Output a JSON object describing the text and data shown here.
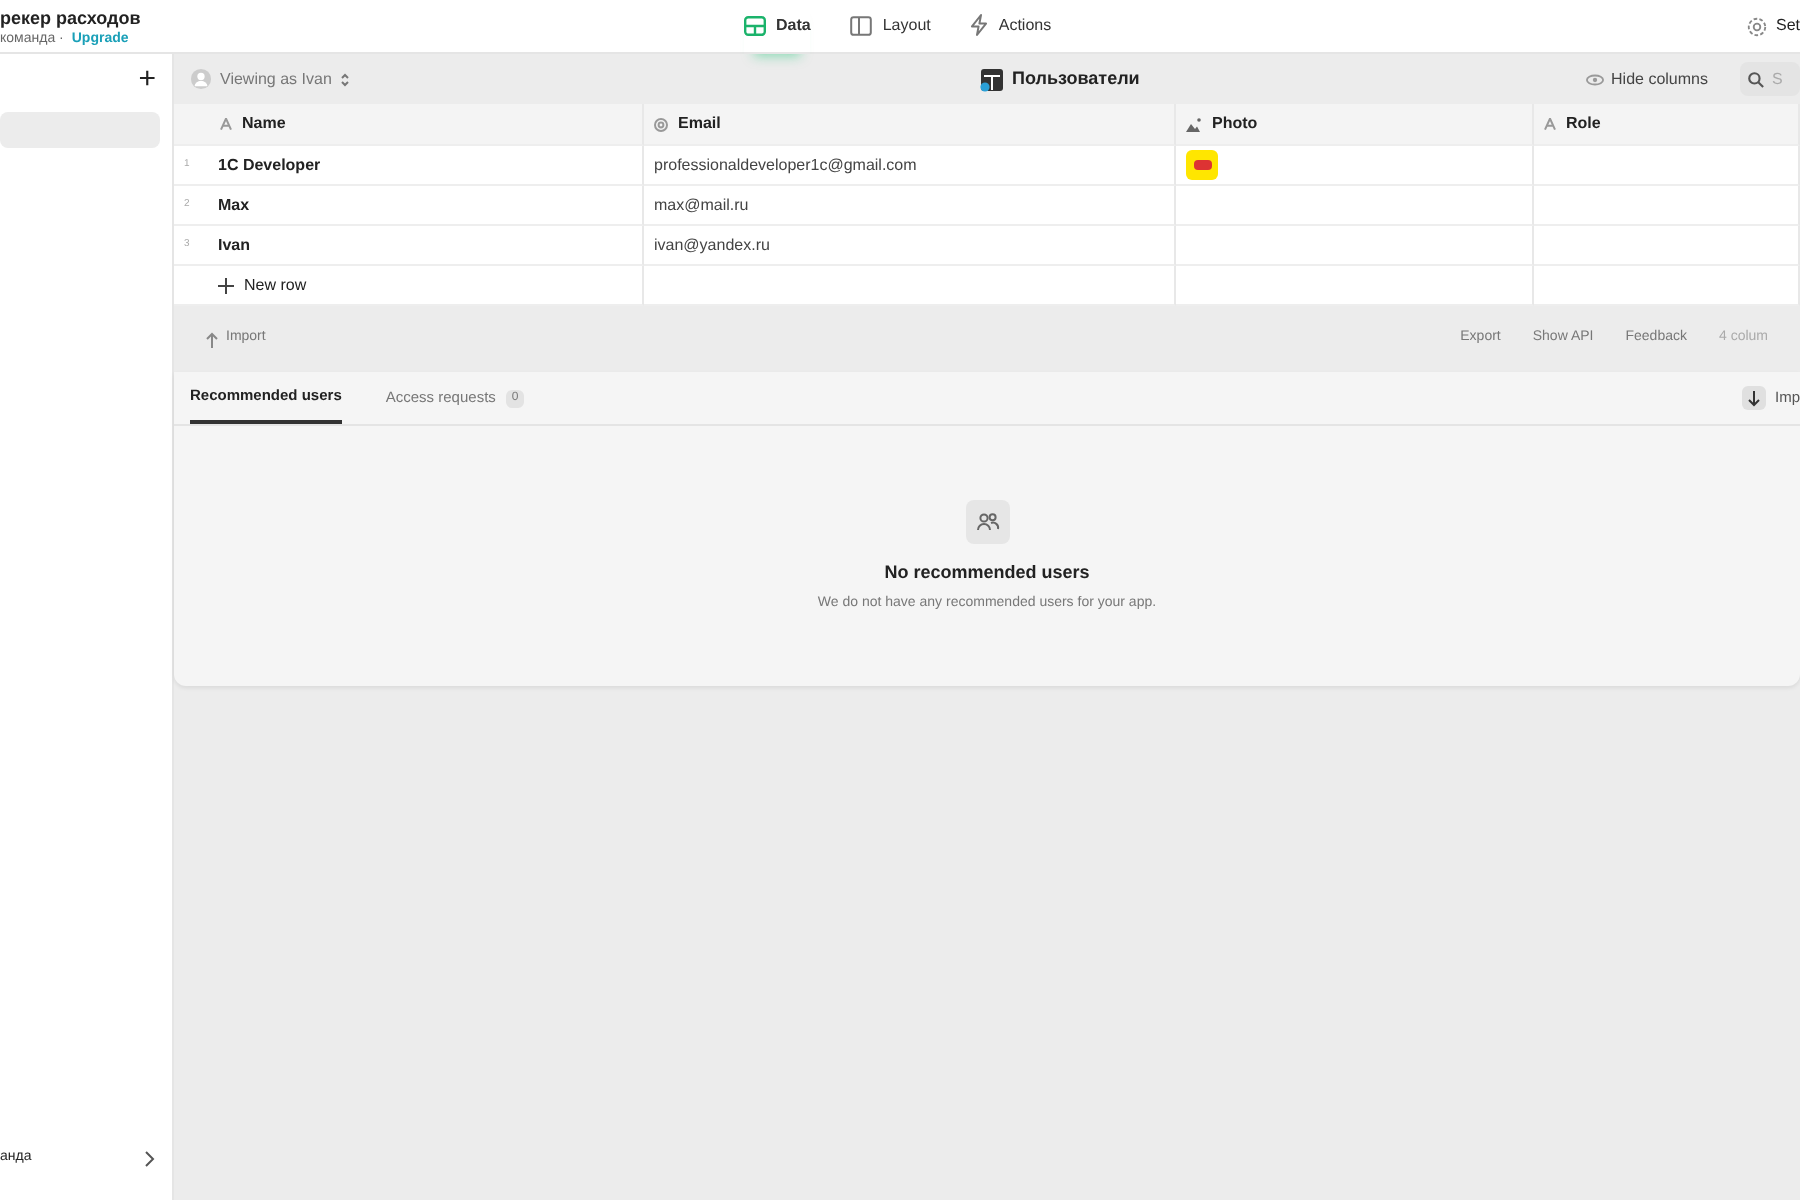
{
  "app": {
    "title": "рекер расходов",
    "subtitle": "команда ·",
    "upgrade_link": "Upgrade"
  },
  "top_tabs": [
    {
      "label": "Data",
      "kind": "data",
      "selected": true
    },
    {
      "label": "Layout",
      "kind": "layout",
      "selected": false
    },
    {
      "label": "Actions",
      "kind": "actions",
      "selected": false
    }
  ],
  "settings_label": "Set",
  "sidebar": {
    "add_button": "+",
    "items": [
      {
        "selected": true
      }
    ],
    "footer_label": "анда"
  },
  "toolbar": {
    "viewing_as": "Viewing as Ivan",
    "table_title": "Пользователи",
    "hide_columns": "Hide columns",
    "search_placeholder": "S"
  },
  "table": {
    "columns": [
      {
        "name": "Name",
        "kind": "text"
      },
      {
        "name": "Email",
        "kind": "email"
      },
      {
        "name": "Photo",
        "kind": "image"
      },
      {
        "name": "Role",
        "kind": "text"
      }
    ],
    "rows": [
      {
        "number": "1",
        "name": "1C Developer",
        "email": "professionaldeveloper1c@gmail.com",
        "photo": true
      },
      {
        "number": "2",
        "name": "Max",
        "email": "max@mail.ru",
        "photo": false
      },
      {
        "number": "3",
        "name": "Ivan",
        "email": "ivan@yandex.ru",
        "photo": false
      }
    ],
    "new_row": "New row"
  },
  "footer": {
    "import": "Import",
    "links": [
      "Export",
      "Show API",
      "Feedback"
    ],
    "column_count": "4 colum"
  },
  "user_tabs": [
    {
      "label": "Recommended users",
      "selected": true
    },
    {
      "label": "Access requests",
      "selected": false,
      "count": "0"
    }
  ],
  "user_tabs_button": "Imp",
  "empty_state": {
    "title": "No recommended users",
    "text": "We do not have any recommended users for your app."
  }
}
